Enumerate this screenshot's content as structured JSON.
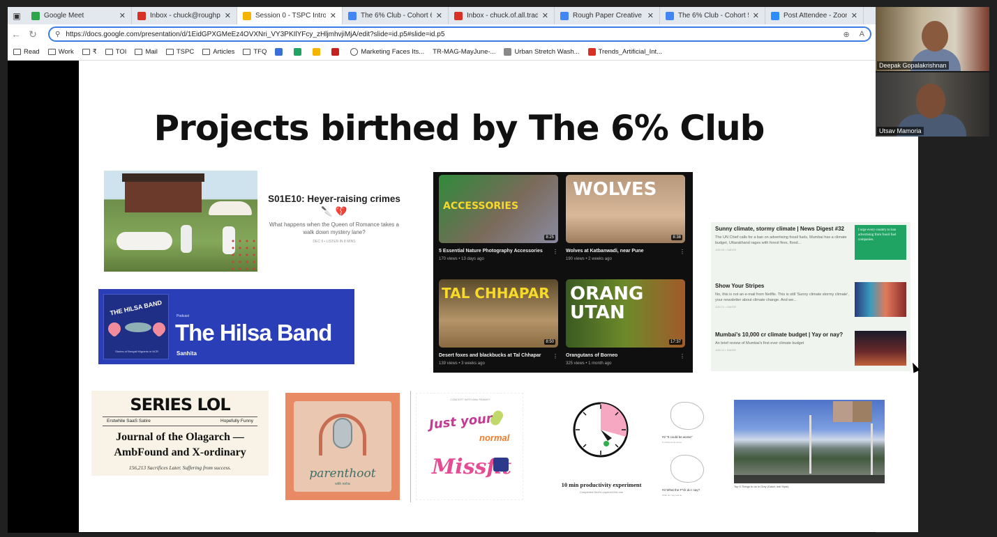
{
  "browser": {
    "tabs": [
      {
        "title": "Google Meet",
        "color": "#2fa54a",
        "active": false
      },
      {
        "title": "Inbox - chuck@roughpaper",
        "color": "#d93025",
        "active": false
      },
      {
        "title": "Session 0 - TSPC Intro - Go",
        "color": "#f4b400",
        "active": true
      },
      {
        "title": "The 6% Club - Cohort 6 | Li",
        "color": "#4285f4",
        "active": false
      },
      {
        "title": "Inbox - chuck.of.all.trades@",
        "color": "#d93025",
        "active": false
      },
      {
        "title": "Rough Paper Creative – Cal",
        "color": "#4285f4",
        "active": false
      },
      {
        "title": "The 6% Club - Cohort 5 | Li",
        "color": "#4285f4",
        "active": false
      },
      {
        "title": "Post Attendee - Zoom",
        "color": "#2d8cff",
        "active": false
      }
    ],
    "url": "https://docs.google.com/presentation/d/1EidGPXGMeEz4OVXNri_VY3PKIlYFcy_zHljmhvjiMjA/edit?slide=id.p5#slide=id.p5",
    "bookmarks": [
      {
        "label": "Read",
        "type": "folder"
      },
      {
        "label": "Work",
        "type": "folder"
      },
      {
        "label": "₹",
        "type": "folder"
      },
      {
        "label": "TOI",
        "type": "folder"
      },
      {
        "label": "Mail",
        "type": "folder"
      },
      {
        "label": "TSPC",
        "type": "folder"
      },
      {
        "label": "Articles",
        "type": "folder"
      },
      {
        "label": "TFQ",
        "type": "folder"
      },
      {
        "label": "",
        "type": "color",
        "color": "#3a6fd8"
      },
      {
        "label": "",
        "type": "color",
        "color": "#1fa463"
      },
      {
        "label": "",
        "type": "color",
        "color": "#f4b400"
      },
      {
        "label": "",
        "type": "color",
        "color": "#c5221f"
      },
      {
        "label": "Marketing Faces Its...",
        "type": "globe"
      },
      {
        "label": "TR-MAG-MayJune-...",
        "type": "plain"
      },
      {
        "label": "Urban Stretch Wash...",
        "type": "color",
        "color": "#888888"
      },
      {
        "label": "Trends_Artificial_Int...",
        "type": "color",
        "color": "#d93025"
      }
    ]
  },
  "slide": {
    "title": "Projects birthed by The 6% Club",
    "heyer": {
      "title": "S01E10: Heyer-raising crimes 🔪 💔",
      "desc": "What happens when the Queen of Romance takes a walk down mystery lane?",
      "meta": "DEC 9 • LISTEN IN 8 MINS"
    },
    "hilsa": {
      "logo_text": "THE HILSA BAND",
      "logo_sub": "Stories of Bengali Migrants in NCR",
      "podcast_label": "Podcast",
      "name": "The Hilsa Band",
      "author": "Sanhita"
    },
    "youtube": [
      {
        "title": "5 Essential Nature Photography Accessories",
        "meta": "170 views • 13 days ago",
        "duration": "8:25",
        "thumb_text": "ACCESSORIES"
      },
      {
        "title": "Wolves at Katbanwadi, near Pune",
        "meta": "190 views • 2 weeks ago",
        "duration": "8:38",
        "thumb_text": "WOLVES"
      },
      {
        "title": "Desert foxes and blackbucks at Tal Chhapar",
        "meta": "139 views • 3 weeks ago",
        "duration": "8:50",
        "thumb_text": "TAL CHHAPAR"
      },
      {
        "title": "Orangutans of Borneo",
        "meta": "325 views • 1 month ago",
        "duration": "17:37",
        "thumb_text": "ORANG UTAN"
      }
    ],
    "newsletter": [
      {
        "title": "Sunny climate, stormy climate | News Digest #32",
        "desc": "The UN Chief calls for a ban on advertising fossil fuels, Mumbai has a climate budget, Uttarakhand rages with forest fires, flood...",
        "meta": "JUN 29 • SAKEE"
      },
      {
        "title": "Show Your Stripes",
        "desc": "No, this is not an e-mail from Netflix. This is still 'Sunny climate stormy climate', your newsletter about climate change. And we...",
        "meta": "JUN 21 • SAKEE"
      },
      {
        "title": "Mumbai's 10,000 cr climate budget | Yay or nay?",
        "desc": "An brief review of Mumbai's first ever climate budget",
        "meta": "JUN 11 • SAKEE"
      }
    ],
    "quote_text": "I urge every country to ban advertising from fossil fuel companies.",
    "series_lol": {
      "title": "SERIES LOL",
      "left": "Erstwhile SaaS Satire",
      "right": "Hopefully Funny",
      "headline": "Journal of the Olagarch — AmbFound and X-ordinary",
      "tagline": "156,213 Sacrifices Later. Suffering from success."
    },
    "parenthoot": {
      "name": "parenthoot",
      "sub": "with neha"
    },
    "missfit": {
      "top": "CONCEPT WITH ANU PANDEY",
      "just": "Just your",
      "normal": "normal",
      "miss": "Missfit"
    },
    "productivity": {
      "title": "10 min productivity experiment",
      "desc": "Completed Neel's required this one"
    },
    "sketches": [
      {
        "title": "#2 \"It could be worse\"",
        "sub": "It could just be worse"
      },
      {
        "title": "#3 What the F*ck do I say?",
        "sub": "What do I say and do"
      }
    ],
    "landscape_caption": "Top 5 Things to do in Ooty (Dutch Indi Style)"
  },
  "zoom": {
    "participants": [
      {
        "name": "Deepak Gopalakrishnan"
      },
      {
        "name": "Utsav Mamoria"
      }
    ]
  }
}
